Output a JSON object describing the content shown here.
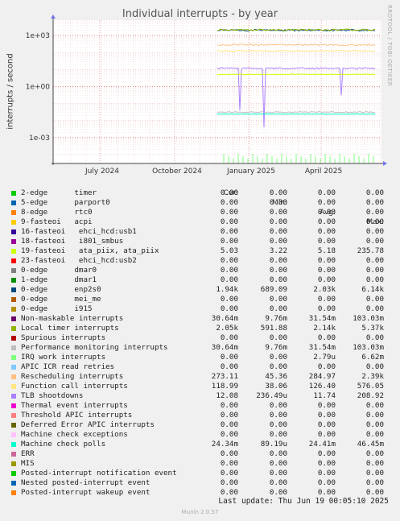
{
  "title": "Individual interrupts - by year",
  "side_label": "RRDTOOL / TOBI OETIKER",
  "footer": {
    "last_update": "Last update: Thu Jun 19 00:05:10 2025",
    "version": "Munin 2.0.57"
  },
  "chart_data": {
    "type": "line",
    "title": "Individual interrupts - by year",
    "ylabel": "interrupts / second",
    "y_scale": "log",
    "yticks": [
      {
        "value": 1000,
        "label": "1e+03"
      },
      {
        "value": 1,
        "label": "1e+00"
      },
      {
        "value": 0.001,
        "label": "1e-03"
      }
    ],
    "xticks": [
      "July 2024",
      "October 2024",
      "January 2025",
      "April 2025"
    ],
    "grid": true,
    "columns": [
      "Cur:",
      "Min:",
      "Avg:",
      "Max:"
    ],
    "series": [
      {
        "name": "2-edge      timer",
        "color": "#00cc00",
        "cur": "0.00",
        "min": "0.00",
        "avg": "0.00",
        "max": "0.00"
      },
      {
        "name": "5-edge      parport0",
        "color": "#0066b3",
        "cur": "0.00",
        "min": "0.00",
        "avg": "0.00",
        "max": "0.00"
      },
      {
        "name": "8-edge      rtc0",
        "color": "#ff8000",
        "cur": "0.00",
        "min": "0.00",
        "avg": "0.00",
        "max": "0.00"
      },
      {
        "name": "9-fasteoi   acpi",
        "color": "#ffcc00",
        "cur": "0.00",
        "min": "0.00",
        "avg": "0.00",
        "max": "0.00"
      },
      {
        "name": "16-fasteoi   ehci_hcd:usb1",
        "color": "#330099",
        "cur": "0.00",
        "min": "0.00",
        "avg": "0.00",
        "max": "0.00"
      },
      {
        "name": "18-fasteoi   i801_smbus",
        "color": "#990099",
        "cur": "0.00",
        "min": "0.00",
        "avg": "0.00",
        "max": "0.00"
      },
      {
        "name": "19-fasteoi   ata_piix, ata_piix",
        "color": "#ccff00",
        "cur": "5.03",
        "min": "3.22",
        "avg": "5.18",
        "max": "235.78"
      },
      {
        "name": "23-fasteoi   ehci_hcd:usb2",
        "color": "#ff0000",
        "cur": "0.00",
        "min": "0.00",
        "avg": "0.00",
        "max": "0.00"
      },
      {
        "name": "0-edge      dmar0",
        "color": "#808080",
        "cur": "0.00",
        "min": "0.00",
        "avg": "0.00",
        "max": "0.00"
      },
      {
        "name": "1-edge      dmar1",
        "color": "#008f00",
        "cur": "0.00",
        "min": "0.00",
        "avg": "0.00",
        "max": "0.00"
      },
      {
        "name": "0-edge      enp2s0",
        "color": "#00487d",
        "cur": "1.94k",
        "min": "689.09",
        "avg": "2.03k",
        "max": "6.14k"
      },
      {
        "name": "0-edge      mei_me",
        "color": "#b35a00",
        "cur": "0.00",
        "min": "0.00",
        "avg": "0.00",
        "max": "0.00"
      },
      {
        "name": "0-edge      i915",
        "color": "#b38f00",
        "cur": "0.00",
        "min": "0.00",
        "avg": "0.00",
        "max": "0.00"
      },
      {
        "name": "Non-maskable interrupts",
        "color": "#6b006b",
        "cur": "30.64m",
        "min": "9.76m",
        "avg": "31.54m",
        "max": "103.03m"
      },
      {
        "name": "Local timer interrupts",
        "color": "#8fb300",
        "cur": "2.05k",
        "min": "591.88",
        "avg": "2.14k",
        "max": "5.37k"
      },
      {
        "name": "Spurious interrupts",
        "color": "#b30000",
        "cur": "0.00",
        "min": "0.00",
        "avg": "0.00",
        "max": "0.00"
      },
      {
        "name": "Performance monitoring interrupts",
        "color": "#bebebe",
        "cur": "30.64m",
        "min": "9.76m",
        "avg": "31.54m",
        "max": "103.03m"
      },
      {
        "name": "IRQ work interrupts",
        "color": "#80ff80",
        "cur": "0.00",
        "min": "0.00",
        "avg": "2.79u",
        "max": "6.62m"
      },
      {
        "name": "APIC ICR read retries",
        "color": "#80c9ff",
        "cur": "0.00",
        "min": "0.00",
        "avg": "0.00",
        "max": "0.00"
      },
      {
        "name": "Rescheduling interrupts",
        "color": "#ffc080",
        "cur": "273.11",
        "min": "45.36",
        "avg": "284.97",
        "max": "2.39k"
      },
      {
        "name": "Function call interrupts",
        "color": "#ffe680",
        "cur": "118.99",
        "min": "38.06",
        "avg": "126.40",
        "max": "576.05"
      },
      {
        "name": "TLB shootdowns",
        "color": "#aa80ff",
        "cur": "12.08",
        "min": "236.49u",
        "avg": "11.74",
        "max": "208.92"
      },
      {
        "name": "Thermal event interrupts",
        "color": "#ee00cc",
        "cur": "0.00",
        "min": "0.00",
        "avg": "0.00",
        "max": "0.00"
      },
      {
        "name": "Threshold APIC interrupts",
        "color": "#ff8080",
        "cur": "0.00",
        "min": "0.00",
        "avg": "0.00",
        "max": "0.00"
      },
      {
        "name": "Deferred Error APIC interrupts",
        "color": "#666600",
        "cur": "0.00",
        "min": "0.00",
        "avg": "0.00",
        "max": "0.00"
      },
      {
        "name": "Machine check exceptions",
        "color": "#ffbfff",
        "cur": "0.00",
        "min": "0.00",
        "avg": "0.00",
        "max": "0.00"
      },
      {
        "name": "Machine check polls",
        "color": "#00ffcc",
        "cur": "24.34m",
        "min": "89.19u",
        "avg": "24.41m",
        "max": "46.45m"
      },
      {
        "name": "ERR",
        "color": "#cc6699",
        "cur": "0.00",
        "min": "0.00",
        "avg": "0.00",
        "max": "0.00"
      },
      {
        "name": "MIS",
        "color": "#999900",
        "cur": "0.00",
        "min": "0.00",
        "avg": "0.00",
        "max": "0.00"
      },
      {
        "name": "Posted-interrupt notification event",
        "color": "#00cc00",
        "cur": "0.00",
        "min": "0.00",
        "avg": "0.00",
        "max": "0.00"
      },
      {
        "name": "Nested posted-interrupt event",
        "color": "#0066b3",
        "cur": "0.00",
        "min": "0.00",
        "avg": "0.00",
        "max": "0.00"
      },
      {
        "name": "Posted-interrupt wakeup event",
        "color": "#ff8000",
        "cur": "0.00",
        "min": "0.00",
        "avg": "0.00",
        "max": "0.00"
      }
    ]
  }
}
